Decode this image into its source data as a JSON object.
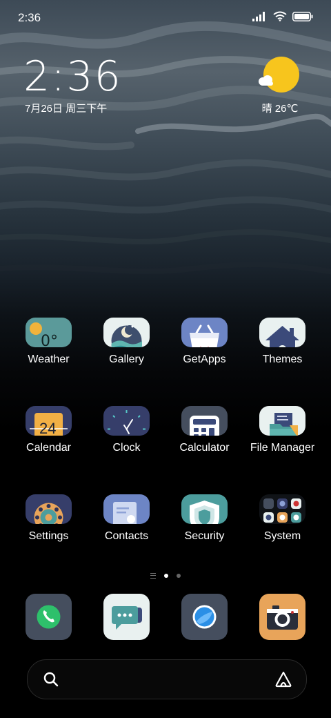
{
  "status_bar": {
    "time": "2:36"
  },
  "lockclock": {
    "time": "2:36",
    "date": "7月26日 周三下午"
  },
  "weather_widget": {
    "text": "晴 26℃"
  },
  "apps": [
    [
      {
        "name": "Weather"
      },
      {
        "name": "Gallery"
      },
      {
        "name": "GetApps"
      },
      {
        "name": "Themes"
      }
    ],
    [
      {
        "name": "Calendar"
      },
      {
        "name": "Clock"
      },
      {
        "name": "Calculator"
      },
      {
        "name": "File Manager"
      }
    ],
    [
      {
        "name": "Settings"
      },
      {
        "name": "Contacts"
      },
      {
        "name": "Security"
      },
      {
        "name": "System"
      }
    ]
  ],
  "icon_text": {
    "weather_temp": "0°",
    "calendar_day": "24"
  },
  "page_indicator": {
    "pages": 2,
    "active": 1
  },
  "dock": [
    "phone-icon",
    "messaging-icon",
    "browser-icon",
    "camera-icon"
  ],
  "colors": {
    "sun": "#f7c51d",
    "dock_bg": "#454e5e"
  }
}
